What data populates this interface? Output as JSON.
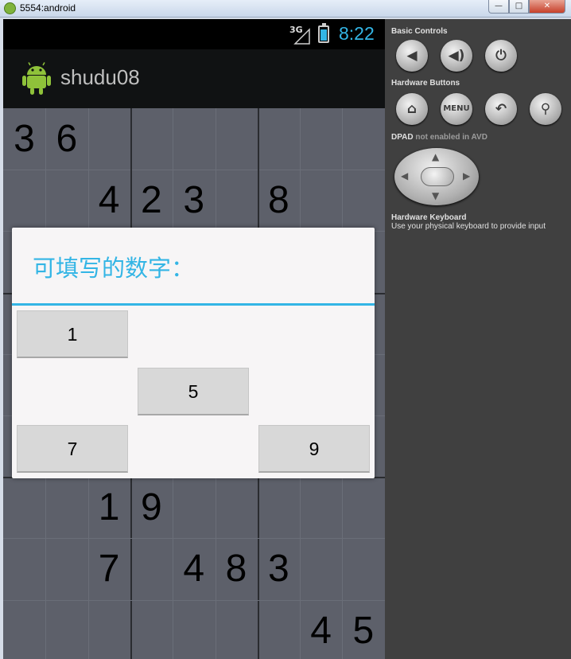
{
  "window": {
    "title": "5554:android",
    "min": "—",
    "max": "□",
    "close": "✕"
  },
  "statusbar": {
    "network": "3G",
    "time": "8:22"
  },
  "app": {
    "title": "shudu08"
  },
  "board": {
    "cells": [
      {
        "r": 0,
        "c": 0,
        "v": "3"
      },
      {
        "r": 0,
        "c": 1,
        "v": "6"
      },
      {
        "r": 1,
        "c": 2,
        "v": "4"
      },
      {
        "r": 1,
        "c": 3,
        "v": "2"
      },
      {
        "r": 1,
        "c": 4,
        "v": "3"
      },
      {
        "r": 1,
        "c": 6,
        "v": "8"
      },
      {
        "r": 6,
        "c": 2,
        "v": "1"
      },
      {
        "r": 6,
        "c": 3,
        "v": "9"
      },
      {
        "r": 7,
        "c": 2,
        "v": "7"
      },
      {
        "r": 7,
        "c": 4,
        "v": "4"
      },
      {
        "r": 7,
        "c": 5,
        "v": "8"
      },
      {
        "r": 7,
        "c": 6,
        "v": "3"
      },
      {
        "r": 8,
        "c": 7,
        "v": "4"
      },
      {
        "r": 8,
        "c": 8,
        "v": "5"
      }
    ]
  },
  "dialog": {
    "title": "可填写的数字：",
    "buttons": [
      {
        "label": "1",
        "row": 0,
        "col": 0
      },
      {
        "label": "5",
        "row": 1,
        "col": 1
      },
      {
        "label": "7",
        "row": 2,
        "col": 0
      },
      {
        "label": "9",
        "row": 2,
        "col": 2
      }
    ]
  },
  "panel": {
    "basic_controls": "Basic Controls",
    "hardware_buttons": "Hardware Buttons",
    "dpad_label": "DPAD",
    "dpad_note": "not enabled in AVD",
    "keyboard_label": "Hardware Keyboard",
    "keyboard_note": "Use your physical keyboard to provide input",
    "menu_label": "MENU",
    "volume_down": "◀",
    "volume_up": "◀)",
    "power": "⏻",
    "home": "⌂",
    "back": "↶",
    "search": "⚲"
  }
}
